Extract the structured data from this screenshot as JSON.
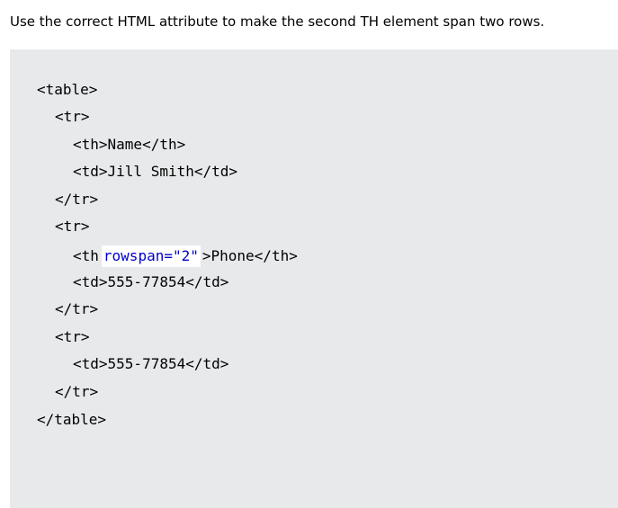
{
  "exercise": {
    "instruction": "Use the correct HTML attribute to make the second TH element span two rows."
  },
  "code": {
    "line1": "<table>",
    "line2": "<tr>",
    "line3": "<th>Name</th>",
    "line4": "<td>Jill Smith</td>",
    "line5": "</tr>",
    "line6": "<tr>",
    "line7_before": "<th",
    "line7_input_value": "rowspan=\"2\"",
    "line7_after": ">Phone</th>",
    "line8": "<td>555-77854</td>",
    "line9": "</tr>",
    "line10": "<tr>",
    "line11": "<td>555-77854</td>",
    "line12": "</tr>",
    "line13": "</table>"
  },
  "colors": {
    "panel_background": "#e7e9eb",
    "input_text": "#0000cd"
  }
}
